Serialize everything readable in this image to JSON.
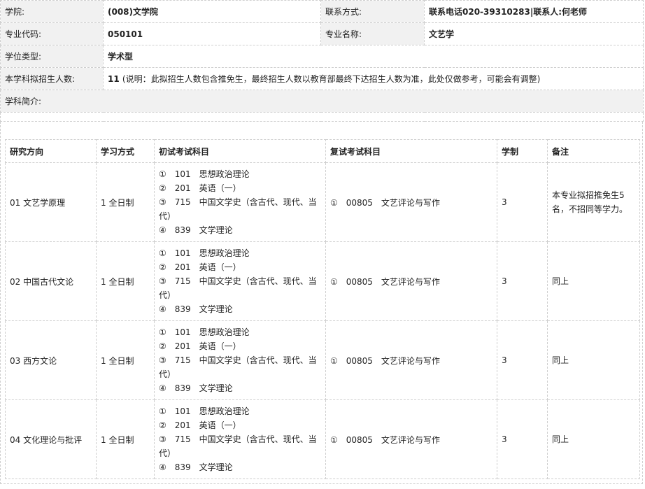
{
  "info": {
    "college_label": "学院:",
    "college_value": "(008)文学院",
    "contact_label": "联系方式:",
    "contact_value": "联系电话020-39310283|联系人:何老师",
    "major_code_label": "专业代码:",
    "major_code_value": "050101",
    "major_name_label": "专业名称:",
    "major_name_value": "文艺学",
    "degree_type_label": "学位类型:",
    "degree_type_value": "学术型",
    "enroll_label": "本学科拟招生人数:",
    "enroll_count": "11",
    "enroll_note": "(说明：此拟招生人数包含推免生，最终招生人数以教育部最终下达招生人数为准，此处仅做参考，可能会有调整)",
    "intro_label": "学科简介:"
  },
  "table": {
    "headers": [
      "研究方向",
      "学习方式",
      "初试考试科目",
      "复试考试科目",
      "学制",
      "备注"
    ],
    "rows": [
      {
        "direction": "01 文艺学原理",
        "mode": "1 全日制",
        "exam": [
          "①　101　思想政治理论",
          "②　201　英语（一）",
          "③　715　中国文学史（含古代、现代、当代）",
          "④　839　文学理论"
        ],
        "retest": "①　00805　文艺评论与写作",
        "years": "3",
        "note": "本专业拟招推免生5名，不招同等学力。"
      },
      {
        "direction": "02 中国古代文论",
        "mode": "1 全日制",
        "exam": [
          "①　101　思想政治理论",
          "②　201　英语（一）",
          "③　715　中国文学史（含古代、现代、当代）",
          "④　839　文学理论"
        ],
        "retest": "①　00805　文艺评论与写作",
        "years": "3",
        "note": "同上"
      },
      {
        "direction": "03 西方文论",
        "mode": "1 全日制",
        "exam": [
          "①　101　思想政治理论",
          "②　201　英语（一）",
          "③　715　中国文学史（含古代、现代、当代）",
          "④　839　文学理论"
        ],
        "retest": "①　00805　文艺评论与写作",
        "years": "3",
        "note": "同上"
      },
      {
        "direction": "04 文化理论与批评",
        "mode": "1 全日制",
        "exam": [
          "①　101　思想政治理论",
          "②　201　英语（一）",
          "③　715　中国文学史（含古代、现代、当代）",
          "④　839　文学理论"
        ],
        "retest": "①　00805　文艺评论与写作",
        "years": "3",
        "note": "同上"
      }
    ]
  }
}
